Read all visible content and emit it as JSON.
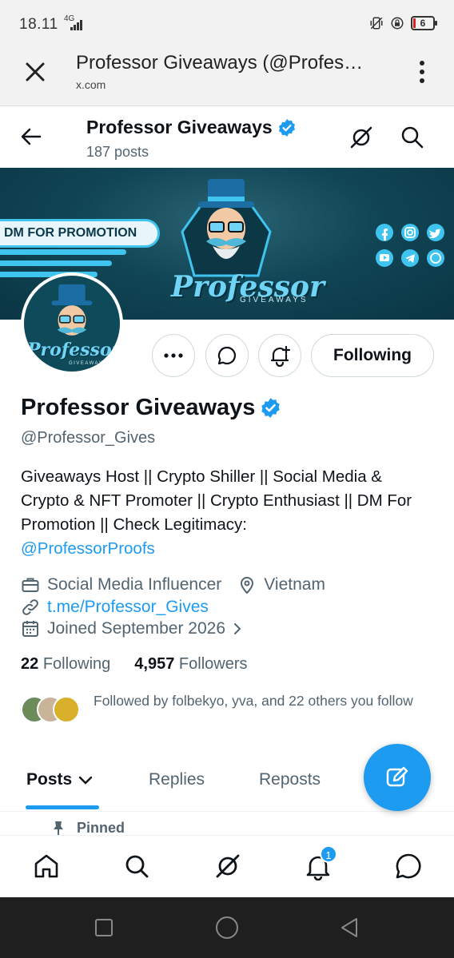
{
  "status_bar": {
    "time": "18.11",
    "network": "4G",
    "battery": "6"
  },
  "browser": {
    "title": "Professor Giveaways (@Profes…",
    "url": "x.com"
  },
  "header": {
    "name": "Professor Giveaways",
    "posts": "187 posts"
  },
  "banner": {
    "promo_text": "DM FOR PROMOTION",
    "logo_text": "Professor",
    "logo_sub": "GIVEAWAYS"
  },
  "avatar": {
    "logo_text": "Professor",
    "logo_sub": "GIVEAWAYS"
  },
  "actions": {
    "following_label": "Following"
  },
  "profile": {
    "name": "Professor Giveaways",
    "handle": "@Professor_Gives",
    "bio": "Giveaways Host || Crypto Shiller || Social Media & Crypto & NFT Promoter || Crypto Enthusiast || DM For Promotion || Check Legitimacy:",
    "bio_link": "@ProfessorProofs",
    "category": "Social Media Influencer",
    "location": "Vietnam",
    "website": "t.me/Professor_Gives",
    "joined": "Joined September 2026",
    "following_count": "22",
    "following_label": "Following",
    "followers_count": "4,957",
    "followers_label": "Followers",
    "followed_by": "Followed by folbekyo, yva, and 22 others you follow"
  },
  "tabs": [
    {
      "label": "Posts"
    },
    {
      "label": "Replies"
    },
    {
      "label": "Reposts"
    }
  ],
  "pinned_label": "Pinned",
  "bottom_nav": {
    "notification_count": "1"
  },
  "colors": {
    "accent": "#1d9bf0",
    "text": "#0f1419",
    "muted": "#536471"
  }
}
